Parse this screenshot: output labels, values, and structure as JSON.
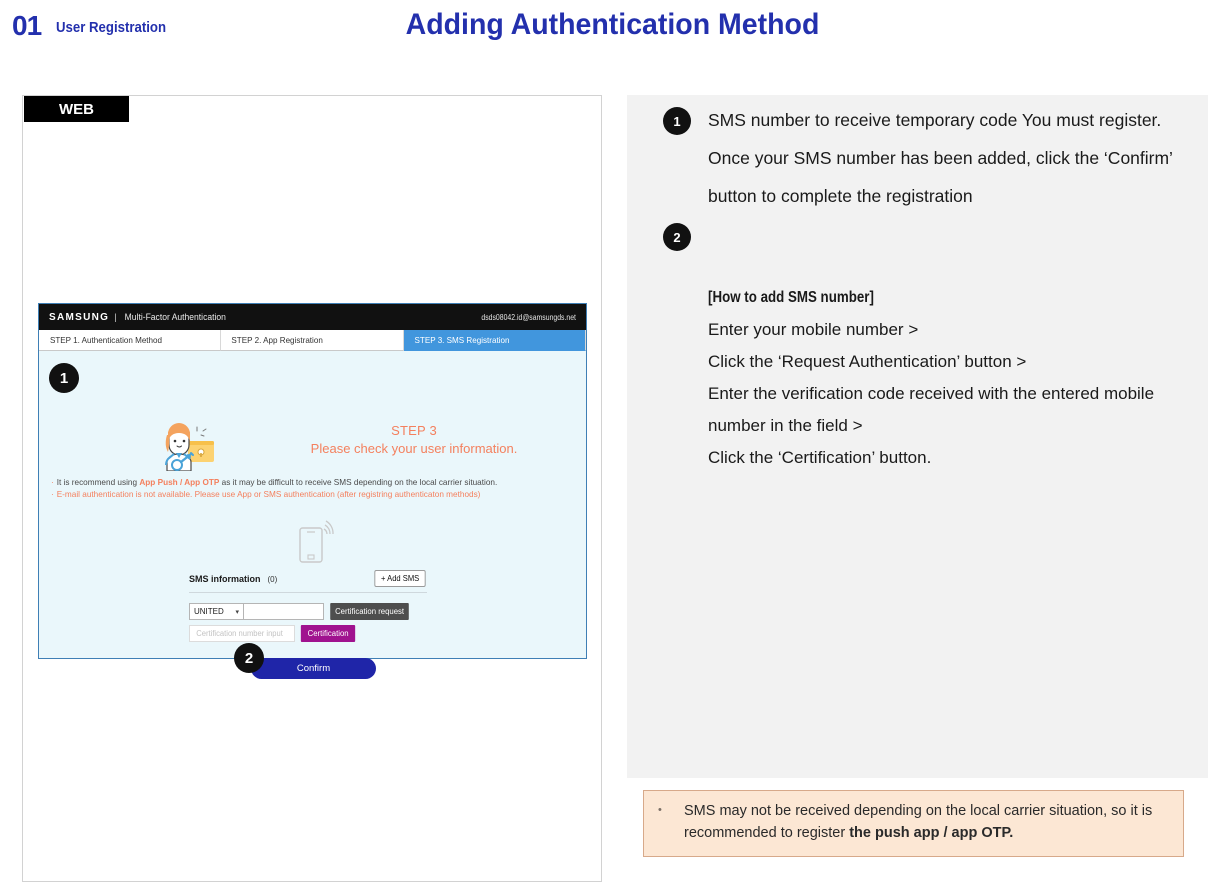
{
  "header": {
    "number": "01",
    "subtitle": "User Registration",
    "title": "Adding Authentication Method"
  },
  "left_panel": {
    "badge": "WEB",
    "mock": {
      "brand": "SAMSUNG",
      "brand_separator": "|",
      "brand_product": "Multi-Factor Authentication",
      "account_email": "dsds08042.id@samsungds.net",
      "steps": [
        {
          "label": "STEP 1. Authentication Method",
          "active": false
        },
        {
          "label": "STEP 2. App Registration",
          "active": false
        },
        {
          "label": "STEP 3. SMS Registration",
          "active": true
        }
      ],
      "marker_1": "1",
      "marker_2": "2",
      "step_title": "STEP 3",
      "step_subtitle": "Please check your user information.",
      "note_1_prefix": "It is recommend using ",
      "note_1_highlight": "App Push / App OTP",
      "note_1_suffix": " as it may be difficult to receive SMS depending on the local carrier situation.",
      "note_2": "E-mail authentication is not available. Please use App or SMS authentication (after registring authenticaton methods)",
      "sms_info_label": "SMS information",
      "sms_info_count": "(0)",
      "add_sms_button": "+ Add SMS",
      "country_value": "UNITED",
      "phone_input_value": "",
      "certification_request_button": "Certification request",
      "certification_input_placeholder": "Certification number input",
      "certification_button": "Certification",
      "confirm_button": "Confirm"
    }
  },
  "right_panel": {
    "marker_1": "1",
    "marker_2": "2",
    "paragraph_1": "SMS number to receive temporary code You must register.",
    "paragraph_2": "Once your SMS number has been added, click the ‘Confirm’ button to complete the registration",
    "howto_heading": "[How to add SMS number]",
    "howto_steps": [
      "Enter your mobile number >",
      "Click the ‘Request Authentication’ button >",
      "Enter the verification code received with the entered mobile number in the field >",
      "Click the ‘Certification’ button."
    ],
    "note": {
      "bullet": "•",
      "text_plain": "SMS may not be received depending on the local carrier situation, so it is recommended to register ",
      "text_bold": "the push app / app OTP."
    }
  },
  "colors": {
    "brand_blue": "#2330ad",
    "tab_active": "#4196dd",
    "accent_orange": "#f4805e",
    "magenta": "#a0128f",
    "confirm_blue": "#1f25a8",
    "note_bg": "#fce7d4",
    "panel_gray": "#f2f2f2"
  }
}
